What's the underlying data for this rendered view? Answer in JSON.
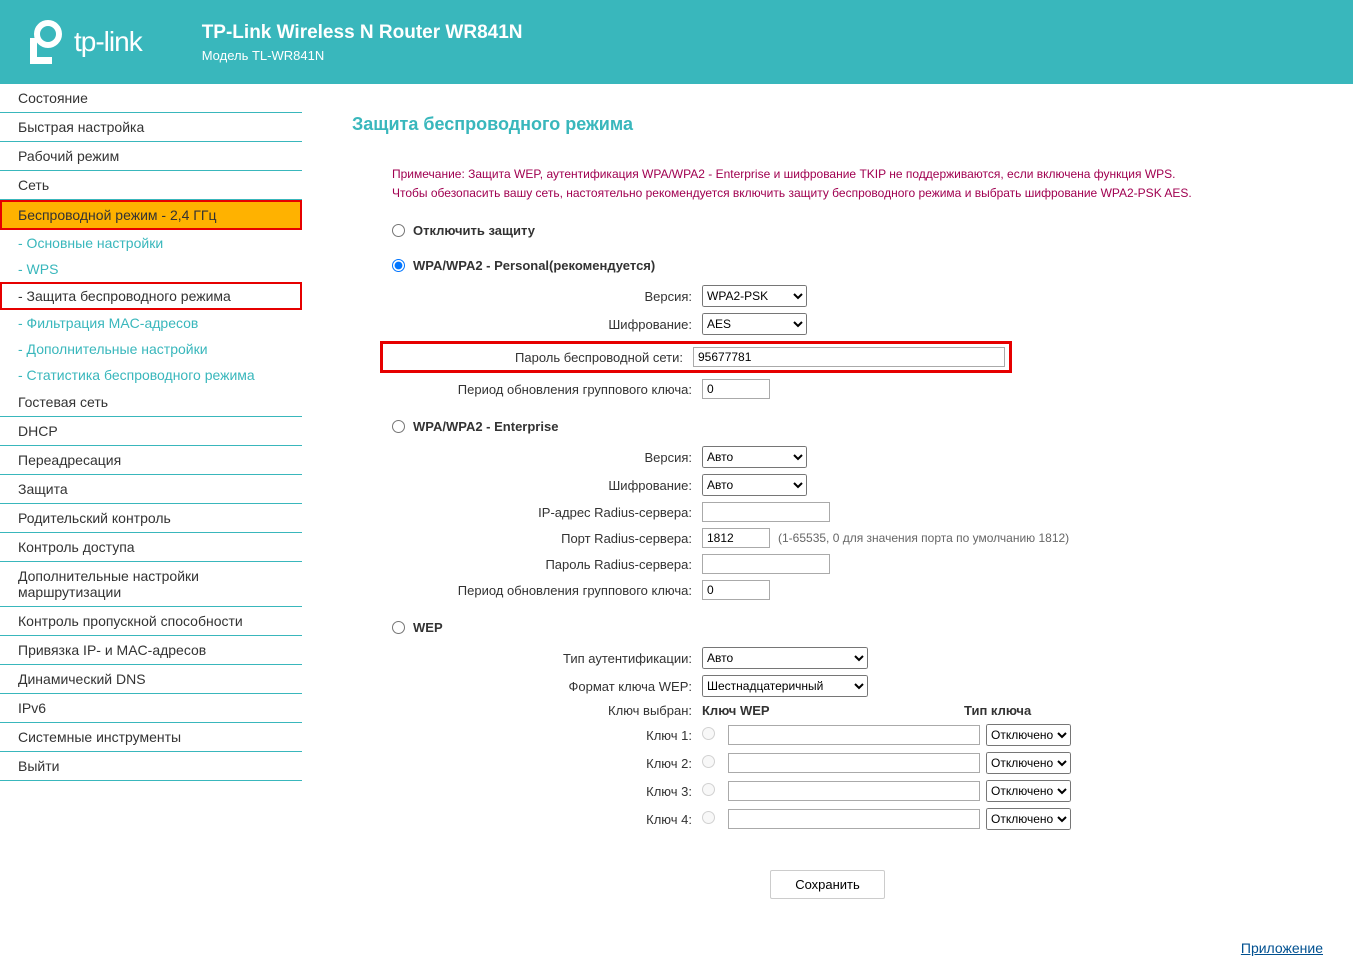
{
  "header": {
    "brand": "tp-link",
    "title": "TP-Link Wireless N Router WR841N",
    "model": "Модель TL-WR841N"
  },
  "sidebar": {
    "items": [
      {
        "label": "Состояние",
        "type": "item"
      },
      {
        "label": "Быстрая настройка",
        "type": "item"
      },
      {
        "label": "Рабочий режим",
        "type": "item"
      },
      {
        "label": "Сеть",
        "type": "item"
      },
      {
        "label": "Беспроводной режим - 2,4 ГГц",
        "type": "item-active"
      },
      {
        "label": "- Основные настройки",
        "type": "sub"
      },
      {
        "label": "- WPS",
        "type": "sub"
      },
      {
        "label": "- Защита беспроводного режима",
        "type": "sub-highlighted"
      },
      {
        "label": "- Фильтрация MAC-адресов",
        "type": "sub"
      },
      {
        "label": "- Дополнительные настройки",
        "type": "sub"
      },
      {
        "label": "- Статистика беспроводного режима",
        "type": "sub"
      },
      {
        "label": "Гостевая сеть",
        "type": "item"
      },
      {
        "label": "DHCP",
        "type": "item"
      },
      {
        "label": "Переадресация",
        "type": "item"
      },
      {
        "label": "Защита",
        "type": "item"
      },
      {
        "label": "Родительский контроль",
        "type": "item"
      },
      {
        "label": "Контроль доступа",
        "type": "item"
      },
      {
        "label": "Дополнительные настройки маршрутизации",
        "type": "item"
      },
      {
        "label": "Контроль пропускной способности",
        "type": "item"
      },
      {
        "label": "Привязка IP- и MAC-адресов",
        "type": "item"
      },
      {
        "label": "Динамический DNS",
        "type": "item"
      },
      {
        "label": "IPv6",
        "type": "item"
      },
      {
        "label": "Системные инструменты",
        "type": "item"
      },
      {
        "label": "Выйти",
        "type": "item"
      }
    ]
  },
  "page": {
    "title": "Защита беспроводного режима",
    "notice1": "Примечание: Защита WEP, аутентификация WPA/WPA2 - Enterprise и шифрование TKIP не поддерживаются, если включена функция WPS.",
    "notice2": "Чтобы обезопасить вашу сеть, настоятельно рекомендуется включить защиту беспроводного режима и выбрать шифрование WPA2-PSK AES."
  },
  "security": {
    "disable_label": "Отключить защиту",
    "wpa_personal": {
      "title": "WPA/WPA2 - Personal(рекомендуется)",
      "version_label": "Версия:",
      "version_value": "WPA2-PSK",
      "encryption_label": "Шифрование:",
      "encryption_value": "AES",
      "password_label": "Пароль беспроводной сети:",
      "password_value": "95677781",
      "group_key_label": "Период обновления группового ключа:",
      "group_key_value": "0"
    },
    "wpa_enterprise": {
      "title": "WPA/WPA2 - Enterprise",
      "version_label": "Версия:",
      "version_value": "Авто",
      "encryption_label": "Шифрование:",
      "encryption_value": "Авто",
      "radius_ip_label": "IP-адрес Radius-сервера:",
      "radius_ip_value": "",
      "radius_port_label": "Порт Radius-сервера:",
      "radius_port_value": "1812",
      "radius_port_hint": "(1-65535, 0 для значения порта по умолчанию 1812)",
      "radius_password_label": "Пароль Radius-сервера:",
      "radius_password_value": "",
      "group_key_label": "Период обновления группового ключа:",
      "group_key_value": "0"
    },
    "wep": {
      "title": "WEP",
      "auth_label": "Тип аутентификации:",
      "auth_value": "Авто",
      "format_label": "Формат ключа WEP:",
      "format_value": "Шестнадцатеричный",
      "selected_label": "Ключ выбран:",
      "col_key": "Ключ WEP",
      "col_type": "Тип ключа",
      "keys": [
        {
          "label": "Ключ 1:",
          "value": "",
          "type": "Отключено"
        },
        {
          "label": "Ключ 2:",
          "value": "",
          "type": "Отключено"
        },
        {
          "label": "Ключ 3:",
          "value": "",
          "type": "Отключено"
        },
        {
          "label": "Ключ 4:",
          "value": "",
          "type": "Отключено"
        }
      ]
    }
  },
  "buttons": {
    "save": "Сохранить"
  },
  "footer": {
    "app_link": "Приложение"
  }
}
